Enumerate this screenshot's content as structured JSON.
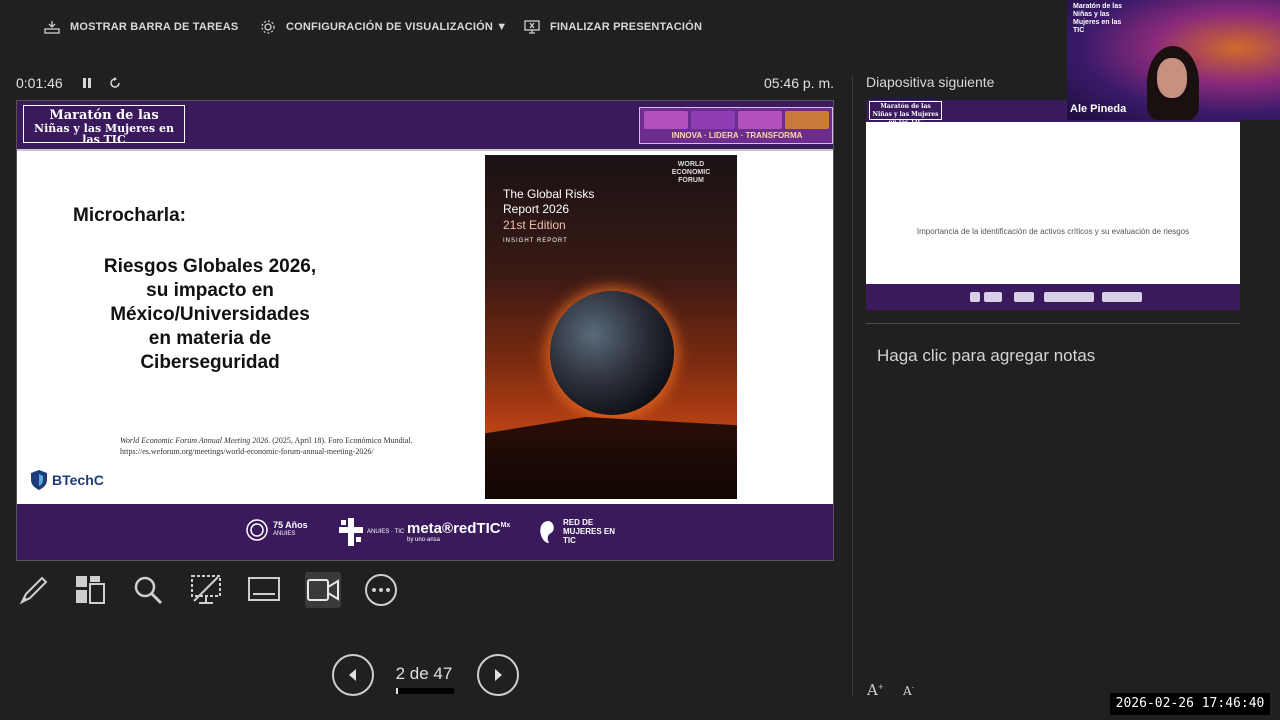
{
  "toolbar": {
    "taskbar_label": "MOSTRAR BARRA DE TAREAS",
    "display_settings_label": "CONFIGURACIÓN DE VISUALIZACIÓN ▼",
    "end_label": "FINALIZAR PRESENTACIÓN"
  },
  "presenter": {
    "elapsed": "0:01:46",
    "clock": "05:46 p. m."
  },
  "slide": {
    "header_logo_line1": "Maratón de las",
    "header_logo_line2": "Niñas y las Mujeres en las TIC",
    "banner_tagline": "INNOVA · LIDERA · TRANSFORMA",
    "title": "Microcharla:",
    "body_line1": "Riesgos Globales 2026,",
    "body_line2": "su impacto en",
    "body_line3": "México/Universidades",
    "body_line4": "en materia de",
    "body_line5": "Ciberseguridad",
    "citation_title": "World Economic Forum Annual Meeting 2026",
    "citation_rest": ". (2025, April 18). Foro Económico Mundial.",
    "citation_url": "https://es.weforum.org/meetings/world-economic-forum-annual-meeting-2026/",
    "btech": "BTechC",
    "cover": {
      "org": "WORLD ECONOMIC FORUM",
      "title_line1": "The Global Risks",
      "title_line2": "Report 2026",
      "edition": "21st Edition",
      "insight": "INSIGHT REPORT"
    },
    "footer": {
      "anuies": "ANUIES",
      "anuies_years": "75 Años",
      "anuies_tic": "ANUIES · TIC",
      "meta": "meta®redTIC",
      "meta_sup": "Mx",
      "meta_sub": "by uno·ansa",
      "red": "RED DE MUJERES EN TIC"
    }
  },
  "navigation": {
    "page_indicator": "2 de 47",
    "progress": 0.0426
  },
  "next_slide": {
    "label": "Diapositiva siguiente",
    "logo": "Maratón de las Niñas y las Mujeres en las TIC",
    "text": "Importancia de la identificación de activos críticos y su evaluación de riesgos"
  },
  "notes": {
    "placeholder": "Haga clic para agregar notas"
  },
  "webcam": {
    "name": "Ale Pineda",
    "overlay_title": "Maratón de las Niñas y las Mujeres en las TIC"
  },
  "timestamp": "2026-02-26  17:46:40",
  "colors": {
    "slide_purple": "#3a1a5c",
    "background": "#202020"
  }
}
